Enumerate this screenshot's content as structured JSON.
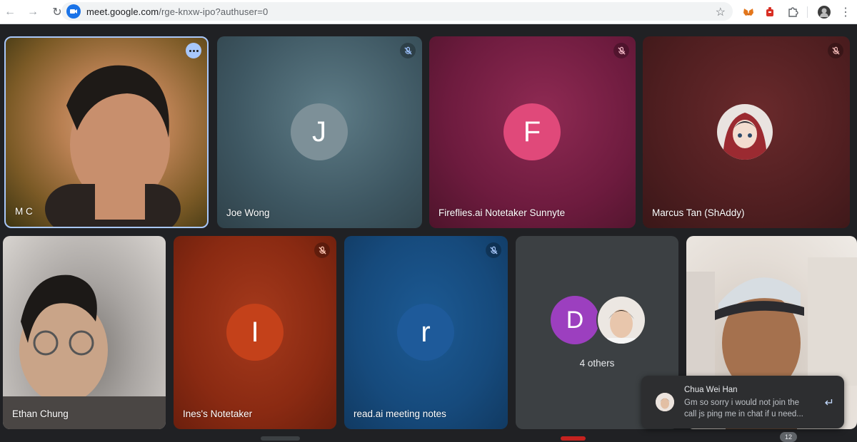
{
  "browser": {
    "url_domain": "meet.google.com",
    "url_path": "/rge-knxw-ipo?authuser=0"
  },
  "tiles": [
    {
      "name": "M C",
      "kind": "video",
      "muted": false,
      "options": true
    },
    {
      "name": "Joe Wong",
      "kind": "avatar",
      "initial": "J",
      "avatar_color": "#7d9098",
      "muted": true
    },
    {
      "name": "Fireflies.ai Notetaker Sunnyte",
      "kind": "avatar",
      "initial": "F",
      "avatar_color": "#e0497a",
      "muted": true
    },
    {
      "name": "Marcus Tan (ShAddy)",
      "kind": "avatar-image",
      "muted": true
    },
    {
      "name": "Ethan Chung",
      "kind": "video",
      "muted": false
    },
    {
      "name": "Ines's Notetaker",
      "kind": "avatar",
      "initial": "I",
      "avatar_color": "#c4411a",
      "muted": true
    },
    {
      "name": "read.ai meeting notes",
      "kind": "avatar",
      "initial": "r",
      "avatar_color": "#1e5a9a",
      "muted": true
    },
    {
      "name": "4 others",
      "kind": "others",
      "initial": "D",
      "avatar_color": "#9c3fbf"
    },
    {
      "name": "",
      "kind": "video"
    }
  ],
  "notification": {
    "sender": "Chua Wei Han",
    "message": "Gm so sorry i would not join the call js ping me in chat if u need..."
  },
  "bottom": {
    "badge": "12"
  },
  "colors": {
    "accent": "#a8c7fa",
    "mute_icon_bg": "rgba(0,0,0,0.25)"
  }
}
